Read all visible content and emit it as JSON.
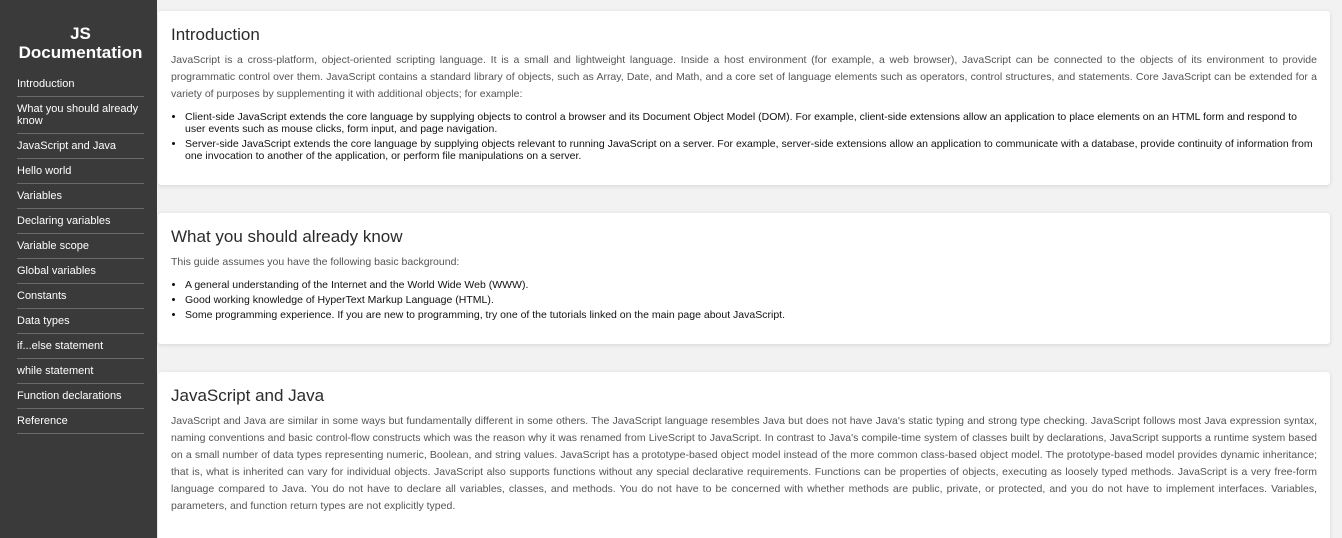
{
  "nav": {
    "title": "JS Documentation",
    "links": [
      "Introduction",
      "What you should already know",
      "JavaScript and Java",
      "Hello world",
      "Variables",
      "Declaring variables",
      "Variable scope",
      "Global variables",
      "Constants",
      "Data types",
      "if...else statement",
      "while statement",
      "Function declarations",
      "Reference"
    ]
  },
  "sections": {
    "introduction": {
      "title": "Introduction",
      "paragraph": "JavaScript is a cross-platform, object-oriented scripting language. It is a small and lightweight language. Inside a host environment (for example, a web browser), JavaScript can be connected to the objects of its environment to provide programmatic control over them. JavaScript contains a standard library of objects, such as Array, Date, and Math, and a core set of language elements such as operators, control structures, and statements. Core JavaScript can be extended for a variety of purposes by supplementing it with additional objects; for example:",
      "items": [
        "Client-side JavaScript extends the core language by supplying objects to control a browser and its Document Object Model (DOM). For example, client-side extensions allow an application to place elements on an HTML form and respond to user events such as mouse clicks, form input, and page navigation.",
        "Server-side JavaScript extends the core language by supplying objects relevant to running JavaScript on a server. For example, server-side extensions allow an application to communicate with a database, provide continuity of information from one invocation to another of the application, or perform file manipulations on a server."
      ]
    },
    "already_know": {
      "title": "What you should already know",
      "paragraph": "This guide assumes you have the following basic background:",
      "items": [
        "A general understanding of the Internet and the World Wide Web (WWW).",
        "Good working knowledge of HyperText Markup Language (HTML).",
        "Some programming experience. If you are new to programming, try one of the tutorials linked on the main page about JavaScript."
      ]
    },
    "javascript_java": {
      "title": "JavaScript and Java",
      "paragraph": "JavaScript and Java are similar in some ways but fundamentally different in some others. The JavaScript language resembles Java but does not have Java's static typing and strong type checking. JavaScript follows most Java expression syntax, naming conventions and basic control-flow constructs which was the reason why it was renamed from LiveScript to JavaScript. In contrast to Java's compile-time system of classes built by declarations, JavaScript supports a runtime system based on a small number of data types representing numeric, Boolean, and string values. JavaScript has a prototype-based object model instead of the more common class-based object model. The prototype-based model provides dynamic inheritance; that is, what is inherited can vary for individual objects. JavaScript also supports functions without any special declarative requirements. Functions can be properties of objects, executing as loosely typed methods. JavaScript is a very free-form language compared to Java. You do not have to declare all variables, classes, and methods. You do not have to be concerned with whether methods are public, private, or protected, and you do not have to implement interfaces. Variables, parameters, and function return types are not explicitly typed."
    }
  },
  "colors": {
    "sidebar_bg": "#3a3a3a",
    "page_bg": "#f2f2f2",
    "card_bg": "#ffffff"
  }
}
